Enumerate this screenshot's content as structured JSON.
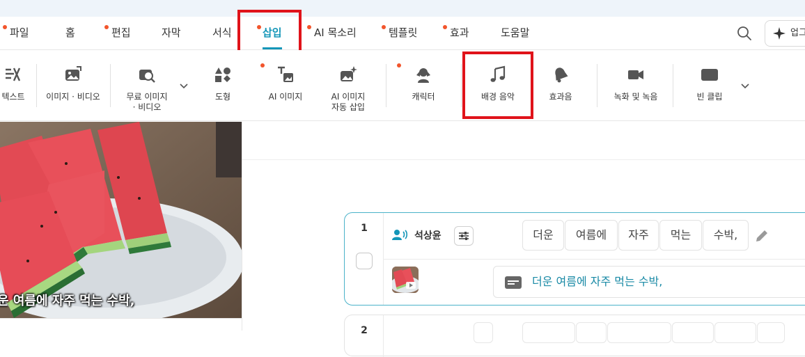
{
  "menu": {
    "tabs": [
      {
        "label": "파일",
        "dot": true
      },
      {
        "label": "홈",
        "dot": false
      },
      {
        "label": "편집",
        "dot": true
      },
      {
        "label": "자막",
        "dot": false
      },
      {
        "label": "서식",
        "dot": false
      },
      {
        "label": "삽입",
        "dot": true,
        "active": true
      },
      {
        "label": "AI 목소리",
        "dot": true
      },
      {
        "label": "템플릿",
        "dot": true
      },
      {
        "label": "효과",
        "dot": true
      },
      {
        "label": "도움말",
        "dot": false
      }
    ],
    "upgrade_label": "업그"
  },
  "ribbon": {
    "items": [
      {
        "label": "텍스트",
        "icon": "text-icon"
      },
      {
        "label": "이미지 · 비디오",
        "icon": "image-video-icon"
      },
      {
        "label": "무료 이미지\n· 비디오",
        "icon": "free-image-search-icon"
      },
      {
        "label": "도형",
        "icon": "shapes-icon"
      },
      {
        "label": "AI 이미지",
        "icon": "ai-image-icon",
        "dot": true
      },
      {
        "label": "AI 이미지\n자동 삽입",
        "icon": "ai-image-auto-icon"
      },
      {
        "label": "캐릭터",
        "icon": "character-icon",
        "dot": true
      },
      {
        "label": "배경 음악",
        "icon": "music-note-icon",
        "highlighted": true
      },
      {
        "label": "효과음",
        "icon": "bell-icon"
      },
      {
        "label": "녹화 및 녹음",
        "icon": "video-camera-icon"
      },
      {
        "label": "빈 클립",
        "icon": "blank-clip-icon"
      }
    ]
  },
  "preview": {
    "caption": "운 여름에 자주 먹는 수박,"
  },
  "script": {
    "clip_number": "1",
    "speaker": "석상윤",
    "words": [
      "더운",
      "여름에",
      "자주",
      "먹는",
      "수박,"
    ],
    "subtitle": "더운 여름에 자주 먹는 수박,",
    "next_clip_number": "2"
  },
  "colors": {
    "accent": "#1496b8",
    "highlight_box": "#e0131a",
    "notification_dot": "#f2552c",
    "card_border": "#4ab2c9"
  }
}
